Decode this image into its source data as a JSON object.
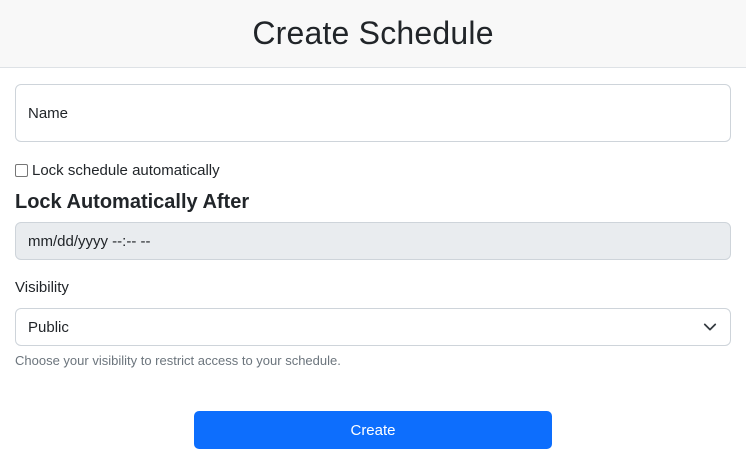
{
  "header": {
    "title": "Create Schedule"
  },
  "form": {
    "name_label": "Name",
    "lock_checkbox": {
      "label": "Lock schedule automatically",
      "checked": false
    },
    "lock_section_title": "Lock Automatically After",
    "lock_datetime_placeholder": "mm/dd/yyyy --:-- --",
    "visibility_label": "Visibility",
    "visibility_selected": "Public",
    "visibility_help": "Choose your visibility to restrict access to your schedule.",
    "submit_label": "Create"
  },
  "icons": {
    "select_chevron": "chevron-down-icon"
  },
  "colors": {
    "primary": "#0d6efd",
    "disabled_field": "#e9ecef",
    "header_bg": "#f8f8f8",
    "muted_text": "#6c757d"
  }
}
